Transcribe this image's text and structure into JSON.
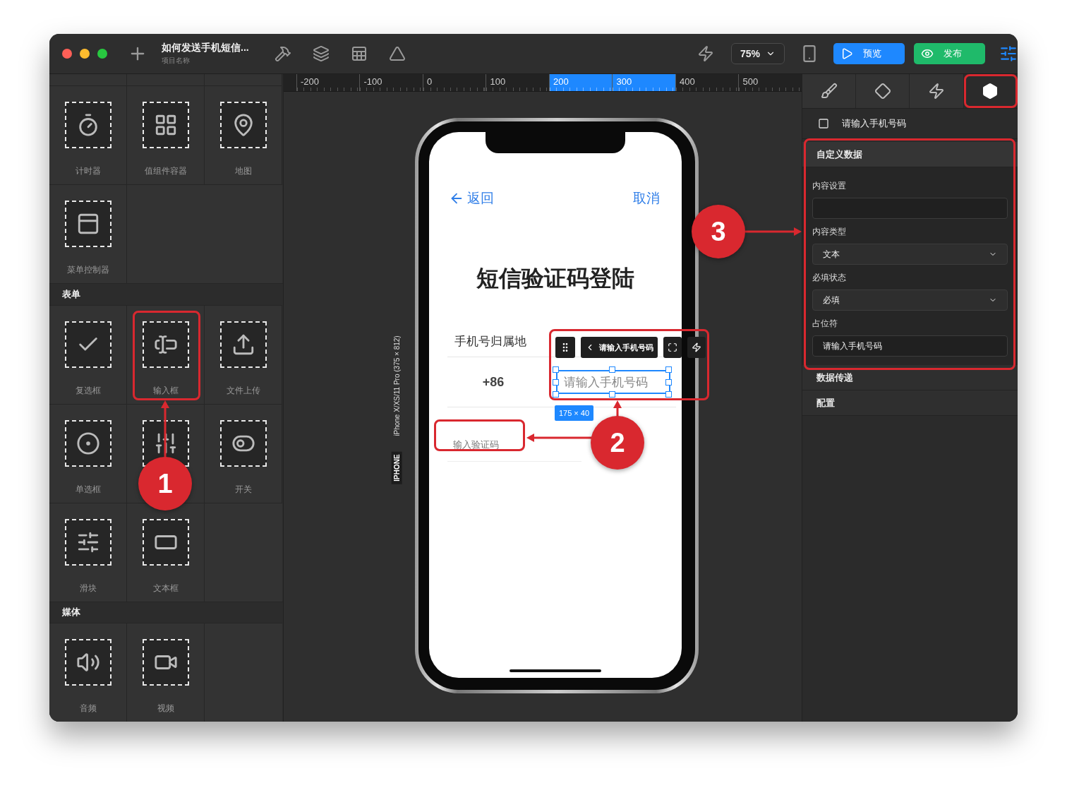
{
  "window": {
    "title": "如何发送手机短信...",
    "subtitle": "项目名称"
  },
  "toolbar": {
    "zoom": "75%",
    "preview_button": "预览",
    "publish_button": "发布"
  },
  "component_groups": [
    {
      "items": [
        {
          "label": "计时器"
        },
        {
          "label": "值组件容器"
        },
        {
          "label": "地图"
        },
        {
          "label": "菜单控制器"
        }
      ]
    },
    {
      "title": "表单",
      "items": [
        {
          "label": "复选框"
        },
        {
          "label": "输入框"
        },
        {
          "label": "文件上传"
        },
        {
          "label": "单选框"
        },
        {
          "kind": "unlabeled"
        },
        {
          "label": "开关"
        },
        {
          "label": "滑块"
        },
        {
          "label": "文本框"
        }
      ]
    },
    {
      "title": "媒体",
      "items": [
        {
          "label": "音频"
        },
        {
          "label": "视频"
        }
      ]
    }
  ],
  "ruler": [
    {
      "label": "-200",
      "highlighted": false
    },
    {
      "label": "-100",
      "highlighted": false
    },
    {
      "label": "0",
      "highlighted": false
    },
    {
      "label": "100",
      "highlighted": false
    },
    {
      "label": "200",
      "highlighted": true
    },
    {
      "label": "300",
      "highlighted": true
    },
    {
      "label": "400",
      "highlighted": false
    },
    {
      "label": "500",
      "highlighted": false
    }
  ],
  "device": {
    "type_label": "IPHONE",
    "model_label": "iPhone X/XS/11 Pro (375  ×  812)"
  },
  "screen": {
    "back_link": "返回",
    "cancel_link": "取消",
    "title": "短信验证码登陆",
    "region_label": "手机号归属地",
    "country_code": "+86",
    "phone_placeholder": "请输入手机号码",
    "code_placeholder": "输入验证码"
  },
  "selection": {
    "label": "请输入手机号码",
    "size": "175 × 40"
  },
  "inspector": {
    "tabs": [
      {
        "selected": false,
        "highlighted": false
      },
      {
        "selected": false,
        "highlighted": false
      },
      {
        "selected": false,
        "highlighted": false
      },
      {
        "selected": true,
        "highlighted": true
      }
    ],
    "layer_name": "请输入手机号码",
    "sections": [
      {
        "title": "自定义数据",
        "expanded": true,
        "fields": [
          {
            "label": "内容设置",
            "kind": "input"
          },
          {
            "label": "内容类型",
            "kind": "select",
            "value": "文本"
          },
          {
            "label": "必填状态",
            "kind": "select",
            "value": "必填"
          },
          {
            "label": "占位符",
            "kind": "input",
            "value": "请输入手机号码"
          }
        ]
      },
      {
        "title": "数据传递",
        "expanded": false
      },
      {
        "title": "配置",
        "expanded": false
      }
    ]
  },
  "annotations": [
    {
      "number": "1"
    },
    {
      "number": "2"
    },
    {
      "number": "3"
    }
  ]
}
